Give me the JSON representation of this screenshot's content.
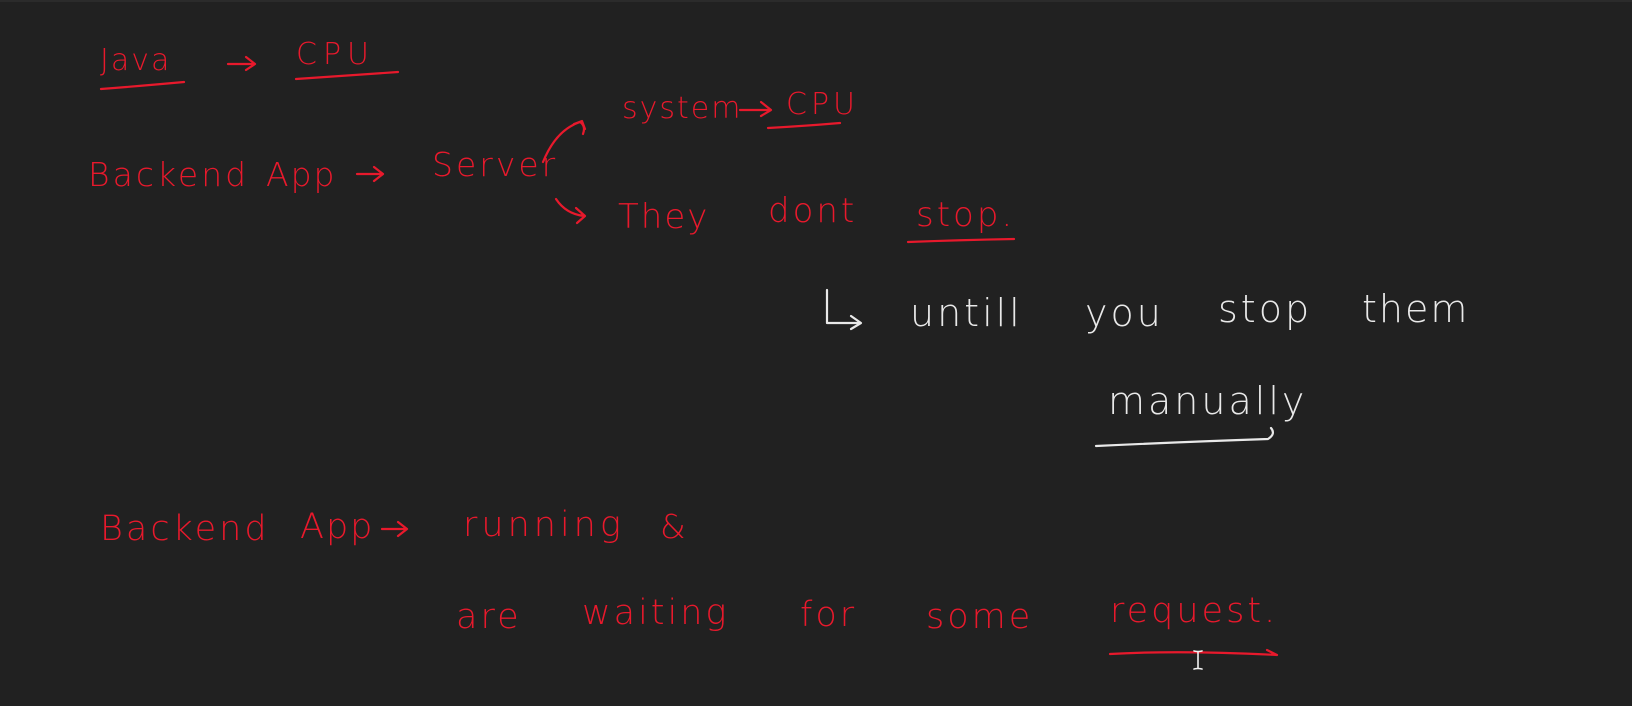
{
  "notes": {
    "line1": {
      "java": "Java",
      "cpu": "CPU"
    },
    "line2": {
      "backend": "Backend",
      "app": "App",
      "server": "Server",
      "system": "system",
      "system_cpu": "CPU",
      "they": "They",
      "dont": "dont",
      "stop": "stop."
    },
    "line3": {
      "until": "untill",
      "you": "you",
      "stop": "stop",
      "them": "them",
      "manually": "manually"
    },
    "line4": {
      "backend": "Backend",
      "app": "App",
      "running": "running",
      "amp": "&",
      "are": "are",
      "waiting": "waiting",
      "for": "for",
      "some": "some",
      "request": "request."
    }
  },
  "colors": {
    "background": "#212121",
    "red_ink": "#e8192c",
    "white_ink": "#e9e9e9"
  }
}
